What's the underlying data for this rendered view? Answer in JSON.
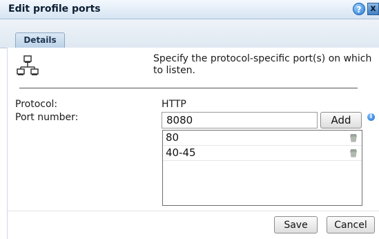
{
  "dialog": {
    "title": "Edit profile ports",
    "help_icon": "?",
    "close_icon": "x"
  },
  "tabs": [
    {
      "label": "Details",
      "active": true
    }
  ],
  "intro": {
    "icon": "network-icon",
    "text": "Specify the protocol-specific port(s) on which to listen."
  },
  "form": {
    "protocol_label": "Protocol:",
    "protocol_value": "HTTP",
    "port_label": "Port number:",
    "port_input_value": "8080",
    "add_label": "Add",
    "info_icon": "i"
  },
  "ports": [
    {
      "value": "80"
    },
    {
      "value": "40-45"
    }
  ],
  "footer": {
    "save_label": "Save",
    "cancel_label": "Cancel"
  }
}
